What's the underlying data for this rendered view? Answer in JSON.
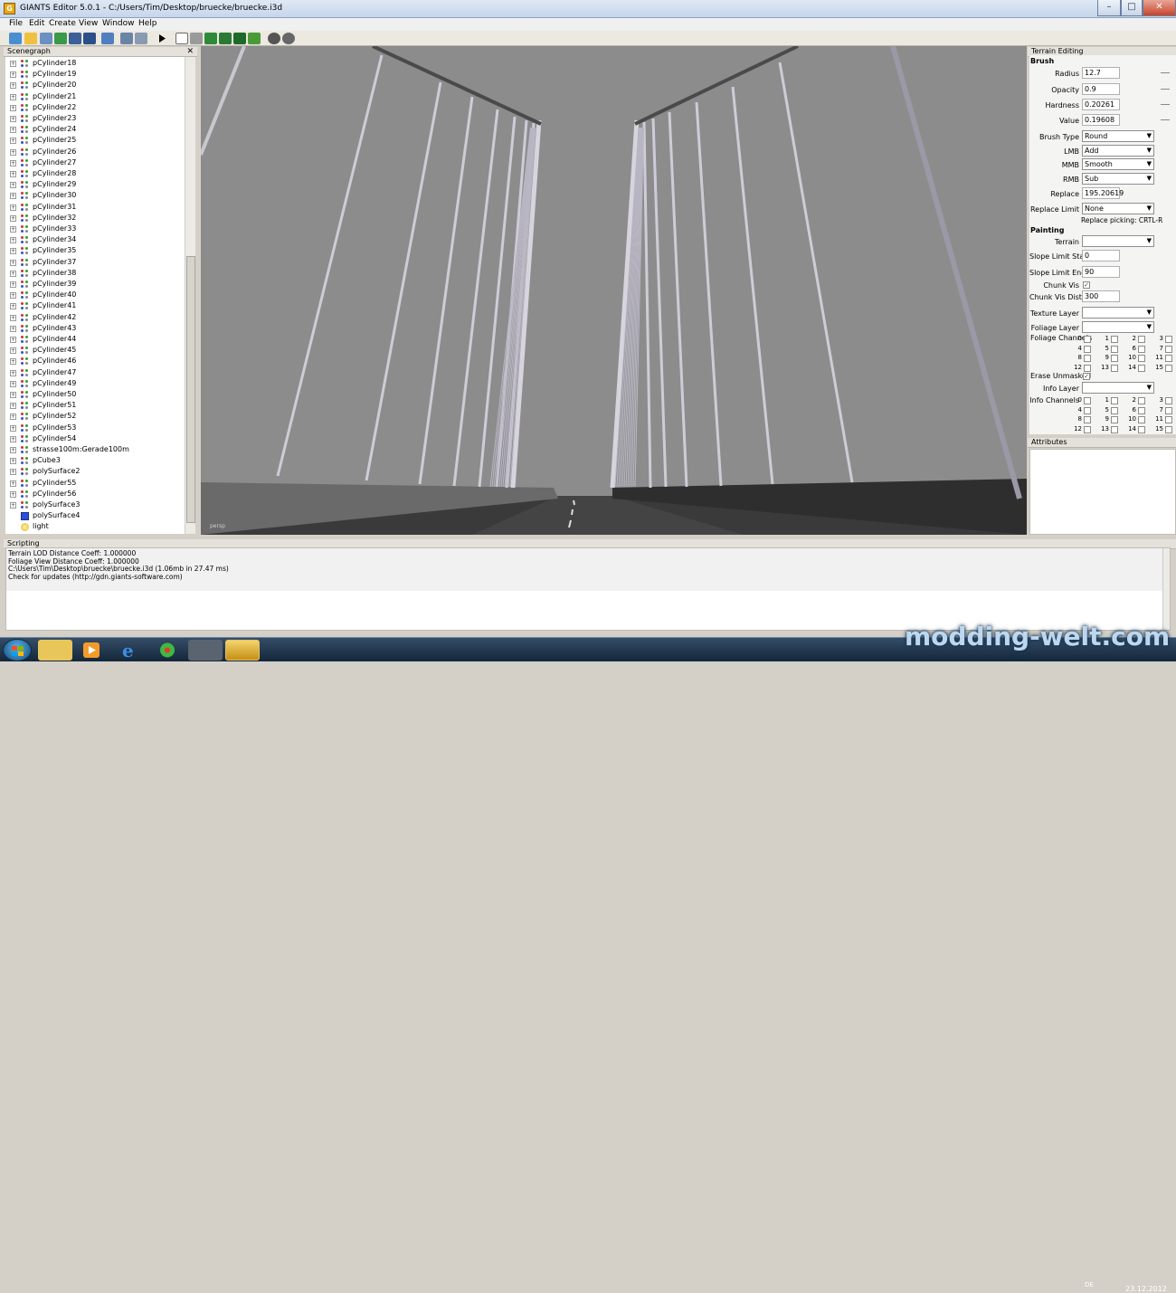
{
  "window": {
    "title": "GIANTS Editor 5.0.1 - C:/Users/Tim/Desktop/bruecke/bruecke.i3d"
  },
  "menu": [
    "File",
    "Edit",
    "Create",
    "View",
    "Window",
    "Help"
  ],
  "scenegraph": {
    "title": "Scenegraph",
    "close": "✕",
    "items": [
      {
        "label": "pCylinder18",
        "type": "transform"
      },
      {
        "label": "pCylinder19",
        "type": "transform"
      },
      {
        "label": "pCylinder20",
        "type": "transform"
      },
      {
        "label": "pCylinder21",
        "type": "transform"
      },
      {
        "label": "pCylinder22",
        "type": "transform"
      },
      {
        "label": "pCylinder23",
        "type": "transform"
      },
      {
        "label": "pCylinder24",
        "type": "transform"
      },
      {
        "label": "pCylinder25",
        "type": "transform"
      },
      {
        "label": "pCylinder26",
        "type": "transform"
      },
      {
        "label": "pCylinder27",
        "type": "transform"
      },
      {
        "label": "pCylinder28",
        "type": "transform"
      },
      {
        "label": "pCylinder29",
        "type": "transform"
      },
      {
        "label": "pCylinder30",
        "type": "transform"
      },
      {
        "label": "pCylinder31",
        "type": "transform"
      },
      {
        "label": "pCylinder32",
        "type": "transform"
      },
      {
        "label": "pCylinder33",
        "type": "transform"
      },
      {
        "label": "pCylinder34",
        "type": "transform"
      },
      {
        "label": "pCylinder35",
        "type": "transform"
      },
      {
        "label": "pCylinder37",
        "type": "transform"
      },
      {
        "label": "pCylinder38",
        "type": "transform"
      },
      {
        "label": "pCylinder39",
        "type": "transform"
      },
      {
        "label": "pCylinder40",
        "type": "transform"
      },
      {
        "label": "pCylinder41",
        "type": "transform"
      },
      {
        "label": "pCylinder42",
        "type": "transform"
      },
      {
        "label": "pCylinder43",
        "type": "transform"
      },
      {
        "label": "pCylinder44",
        "type": "transform"
      },
      {
        "label": "pCylinder45",
        "type": "transform"
      },
      {
        "label": "pCylinder46",
        "type": "transform"
      },
      {
        "label": "pCylinder47",
        "type": "transform"
      },
      {
        "label": "pCylinder49",
        "type": "transform"
      },
      {
        "label": "pCylinder50",
        "type": "transform"
      },
      {
        "label": "pCylinder51",
        "type": "transform"
      },
      {
        "label": "pCylinder52",
        "type": "transform"
      },
      {
        "label": "pCylinder53",
        "type": "transform"
      },
      {
        "label": "pCylinder54",
        "type": "transform"
      },
      {
        "label": "strasse100m:Gerade100m",
        "type": "transform"
      },
      {
        "label": "pCube3",
        "type": "transform"
      },
      {
        "label": "polySurface2",
        "type": "transform"
      },
      {
        "label": "pCylinder55",
        "type": "transform"
      },
      {
        "label": "pCylinder56",
        "type": "transform"
      },
      {
        "label": "polySurface3",
        "type": "transform"
      },
      {
        "label": "polySurface4",
        "type": "shape"
      },
      {
        "label": "light",
        "type": "light"
      }
    ]
  },
  "viewport": {
    "camera": "persp"
  },
  "terrain_editing": {
    "title": "Terrain Editing",
    "brush_heading": "Brush",
    "radius_label": "Radius",
    "radius": "12.7",
    "opacity_label": "Opacity",
    "opacity": "0.9",
    "hardness_label": "Hardness",
    "hardness": "0.20261",
    "value_label": "Value",
    "value": "0.19608",
    "brush_type_label": "Brush Type",
    "brush_type": "Round",
    "lmb_label": "LMB",
    "lmb": "Add",
    "mmb_label": "MMB",
    "mmb": "Smooth",
    "rmb_label": "RMB",
    "rmb": "Sub",
    "replace_label": "Replace",
    "replace": "195.20619",
    "replace_limit_label": "Replace Limit",
    "replace_limit": "None",
    "replace_picking": "Replace picking: CRTL-R",
    "painting_heading": "Painting",
    "terrain_label": "Terrain",
    "terrain": "",
    "slope_start_label": "Slope Limit Start",
    "slope_start": "0",
    "slope_end_label": "Slope Limit End",
    "slope_end": "90",
    "chunk_vis_label": "Chunk Vis",
    "chunk_vis_checked": "✓",
    "chunk_vis_dist_label": "Chunk Vis Dist",
    "chunk_vis_dist": "300",
    "texture_layer_label": "Texture Layer",
    "texture_layer": "",
    "foliage_layer_label": "Foliage Layer",
    "foliage_layer": "",
    "foliage_channels_label": "Foliage Channels",
    "erase_unmasked_label": "Erase Unmasked",
    "erase_unmasked_checked": "✓",
    "info_layer_label": "Info Layer",
    "info_layer": "",
    "info_channels_label": "Info Channels",
    "channel_numbers": [
      "0",
      "1",
      "2",
      "3",
      "4",
      "5",
      "6",
      "7",
      "8",
      "9",
      "10",
      "11",
      "12",
      "13",
      "14",
      "15"
    ]
  },
  "attributes": {
    "title": "Attributes"
  },
  "scripting": {
    "title": "Scripting",
    "lines": [
      "  Terrain LOD Distance Coeff: 1.000000",
      "  Foliage View Distance Coeff: 1.000000",
      "C:\\Users\\Tim\\Desktop\\bruecke\\bruecke.i3d (1.06mb in 27.47 ms)",
      "Check for updates (http://gdn.giants-software.com)"
    ]
  },
  "taskbar": {
    "lang": "DE",
    "date": "23.12.2012"
  },
  "watermark": "modding-welt.com",
  "colors": {
    "viewport_sky": "#8c8c8c",
    "taskbar": "#1e3650",
    "title_bar": "#d6e2f0"
  }
}
